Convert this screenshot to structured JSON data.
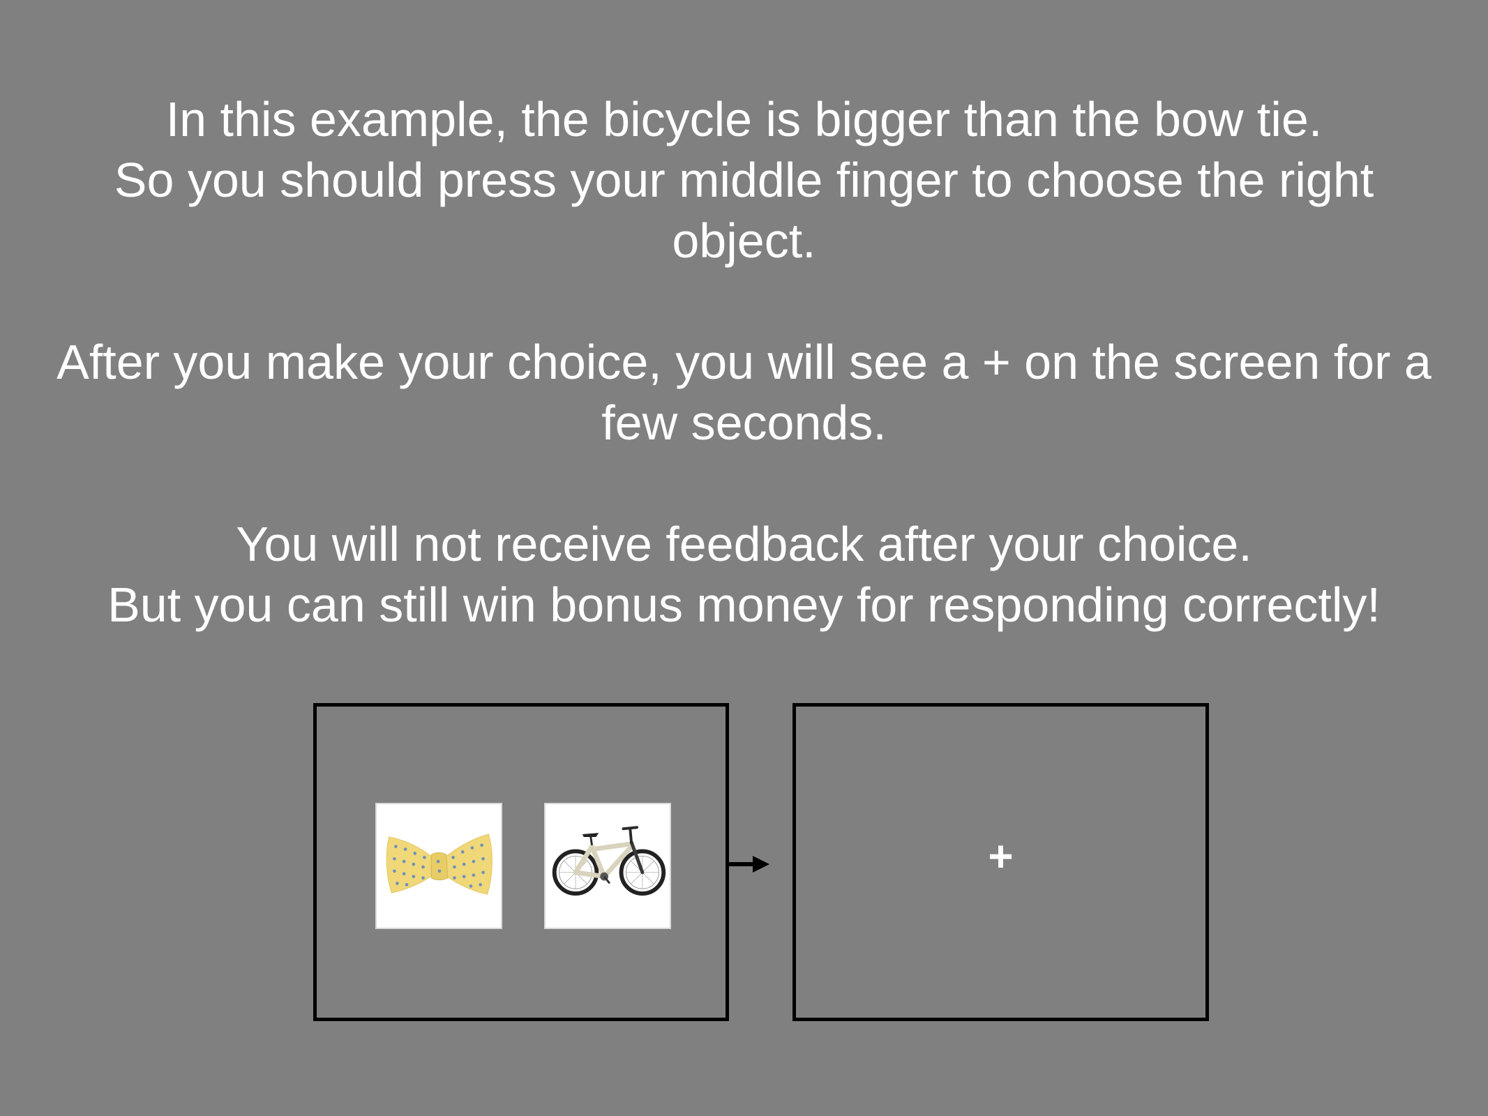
{
  "instructions": {
    "paragraph_1": {
      "line_1": "In this example, the bicycle is bigger than the bow tie.",
      "line_2": "So you should press your middle finger to choose the right object."
    },
    "paragraph_2": "After you make your choice, you will see a + on the screen for a few seconds.",
    "paragraph_3": {
      "line_1": "You will not receive feedback after your choice.",
      "line_2": "But you can still win bonus money for responding correctly!"
    }
  },
  "trial_diagram": {
    "choice_screen": {
      "left_object_icon": "bow-tie-image",
      "right_object_icon": "bicycle-image"
    },
    "arrow_icon": "right-arrow-icon",
    "fixation_screen": {
      "symbol": "+"
    }
  },
  "colors": {
    "background": "#808080",
    "text": "#ffffff",
    "frame_border": "#000000",
    "bowtie": "#f0d878",
    "bowtie_dots": "#6f93b8"
  }
}
